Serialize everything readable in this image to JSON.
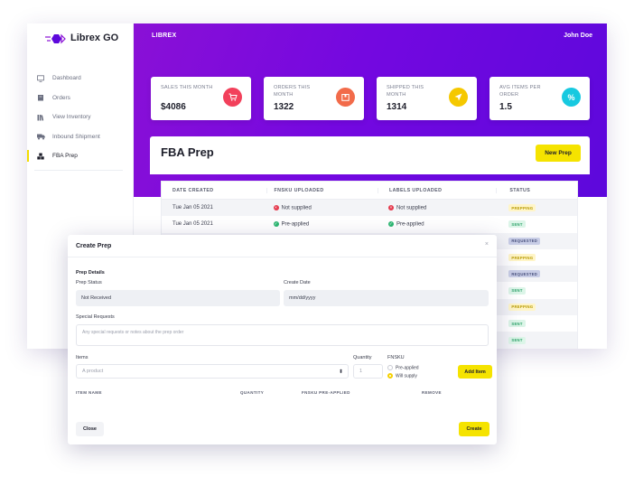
{
  "app": {
    "logo_text": "Librex GO",
    "brand": "LIBREX",
    "user": "John Doe"
  },
  "sidebar": {
    "items": [
      {
        "label": "Dashboard",
        "icon": "monitor-icon",
        "active": false
      },
      {
        "label": "Orders",
        "icon": "box-icon",
        "active": false
      },
      {
        "label": "View Inventory",
        "icon": "books-icon",
        "active": false
      },
      {
        "label": "Inbound Shipment",
        "icon": "truck-icon",
        "active": false
      },
      {
        "label": "FBA Prep",
        "icon": "boxes-icon",
        "active": true
      }
    ]
  },
  "stats": [
    {
      "label": "SALES THIS MONTH",
      "value": "$4086",
      "icon": "cart-icon",
      "color": "#f2405b"
    },
    {
      "label": "ORDERS THIS MONTH",
      "value": "1322",
      "icon": "package-icon",
      "color": "#f26b4a"
    },
    {
      "label": "SHIPPED THIS MONTH",
      "value": "1314",
      "icon": "send-icon",
      "color": "#f5c800"
    },
    {
      "label": "AVG ITEMS PER ORDER",
      "value": "1.5",
      "icon": "percent-icon",
      "color": "#17c9e0"
    }
  ],
  "fba": {
    "title": "FBA Prep",
    "new_button": "New Prep",
    "columns": [
      "DATE CREATED",
      "FNSKU UPLOADED",
      "LABELS UPLOADED",
      "STATUS"
    ],
    "rows": [
      {
        "date": "Tue Jan 05 2021",
        "fnsku": "Not supplied",
        "fnsku_ok": false,
        "labels": "Not supplied",
        "labels_ok": false,
        "status": "PREPPING"
      },
      {
        "date": "Tue Jan 05 2021",
        "fnsku": "Pre-applied",
        "fnsku_ok": true,
        "labels": "Pre-applied",
        "labels_ok": true,
        "status": "SENT"
      },
      {
        "status": "REQUESTED"
      },
      {
        "status": "PREPPING"
      },
      {
        "status": "REQUESTED"
      },
      {
        "status": "SENT"
      },
      {
        "status": "PREPPING"
      },
      {
        "status": "SENT"
      },
      {
        "status": "SENT"
      }
    ]
  },
  "modal": {
    "title": "Create Prep",
    "close_x": "×",
    "section": "Prep Details",
    "prep_status_label": "Prep Status",
    "prep_status_value": "Not Received",
    "create_date_label": "Create Date",
    "create_date_value": "mm/dd/yyyy",
    "special_label": "Special Requests",
    "special_placeholder": "Any special requests or notes about the prep order",
    "items_label": "Items",
    "product_placeholder": "A product",
    "quantity_label": "Quantity",
    "quantity_value": "1",
    "fnsku_label": "FNSKU",
    "fnsku_opt1": "Pre-applied",
    "fnsku_opt2": "Will supply",
    "add_item": "Add Item",
    "item_columns": [
      "ITEM NAME",
      "QUANTITY",
      "FNSKU PRE-APPLIED",
      "REMOVE"
    ],
    "close_button": "Close",
    "create_button": "Create"
  }
}
